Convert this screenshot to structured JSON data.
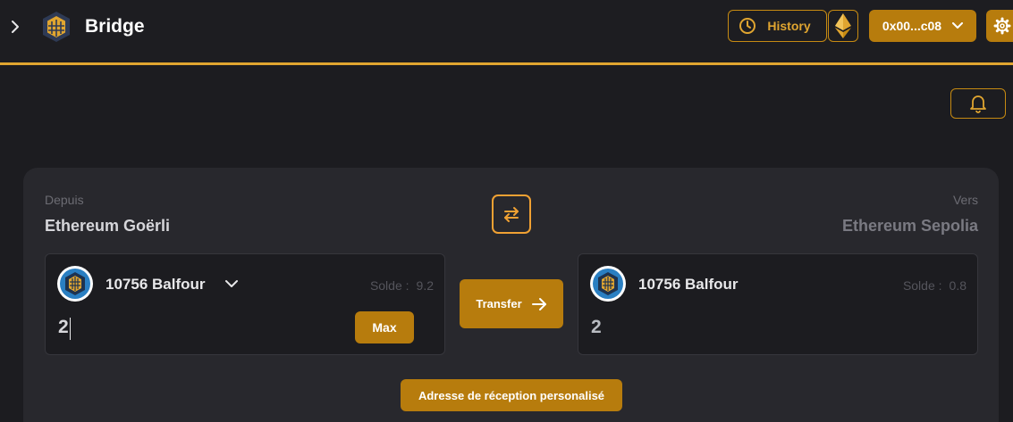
{
  "header": {
    "title": "Bridge",
    "history_label": "History",
    "account_label": "0x00...c08"
  },
  "bridge": {
    "from": {
      "label": "Depuis",
      "network": "Ethereum Goërli",
      "token": "10756 Balfour",
      "balance_label": "Solde :",
      "balance": "9.2",
      "amount": "2",
      "max_label": "Max"
    },
    "to": {
      "label": "Vers",
      "network": "Ethereum Sepolia",
      "token": "10756 Balfour",
      "balance_label": "Solde :",
      "balance": "0.8",
      "amount": "2"
    },
    "transfer_label": "Transfer",
    "custom_address_label": "Adresse de réception personalisé"
  },
  "icons": {
    "sidebar_toggle": "chevron-right-icon",
    "logo": "bridge-logo-icon",
    "history": "clock-icon",
    "network": "ethereum-icon",
    "account": "chevron-down-icon",
    "settings": "gear-icon",
    "notifications": "bell-icon",
    "swap": "swap-arrows-icon",
    "token": "balfour-token-icon",
    "transfer": "arrow-right-icon"
  },
  "colors": {
    "accent": "#b77c0d",
    "accent_light": "#e0a530",
    "background": "#1c1c20",
    "card": "#28282d"
  }
}
